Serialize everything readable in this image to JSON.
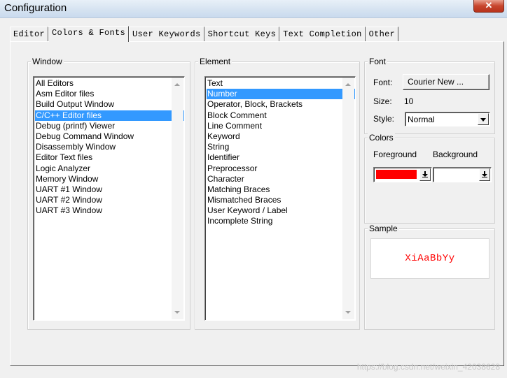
{
  "window": {
    "title": "Configuration",
    "close_glyph": "✕"
  },
  "tabs": [
    {
      "label": "Editor",
      "active": false
    },
    {
      "label": "Colors & Fonts",
      "active": true
    },
    {
      "label": "User Keywords",
      "active": false
    },
    {
      "label": "Shortcut Keys",
      "active": false
    },
    {
      "label": "Text Completion",
      "active": false
    },
    {
      "label": "Other",
      "active": false
    }
  ],
  "window_group": {
    "legend": "Window",
    "items": [
      "All Editors",
      "Asm Editor files",
      "Build Output Window",
      "C/C++ Editor files",
      "Debug (printf) Viewer",
      "Debug Command Window",
      "Disassembly Window",
      "Editor Text files",
      "Logic Analyzer",
      "Memory Window",
      "UART #1 Window",
      "UART #2 Window",
      "UART #3 Window"
    ],
    "selected": "C/C++ Editor files"
  },
  "element_group": {
    "legend": "Element",
    "items": [
      "Text",
      "Number",
      "Operator, Block, Brackets",
      "Block Comment",
      "Line Comment",
      "Keyword",
      "String",
      "Identifier",
      "Preprocessor",
      "Character",
      "Matching Braces",
      "Mismatched Braces",
      "User Keyword / Label",
      "Incomplete String"
    ],
    "selected": "Number"
  },
  "font_group": {
    "legend": "Font",
    "font_label": "Font:",
    "font_value": "Courier New ...",
    "size_label": "Size:",
    "size_value": "10",
    "style_label": "Style:",
    "style_value": "Normal"
  },
  "colors_group": {
    "legend": "Colors",
    "foreground_label": "Foreground",
    "background_label": "Background",
    "foreground_color": "#ff0000",
    "background_color": "#ffffff"
  },
  "sample_group": {
    "legend": "Sample",
    "text": "XiAaBbYy",
    "text_color": "#ff0000"
  },
  "watermark": "https://blog.csdn.net/weixin_42038628"
}
